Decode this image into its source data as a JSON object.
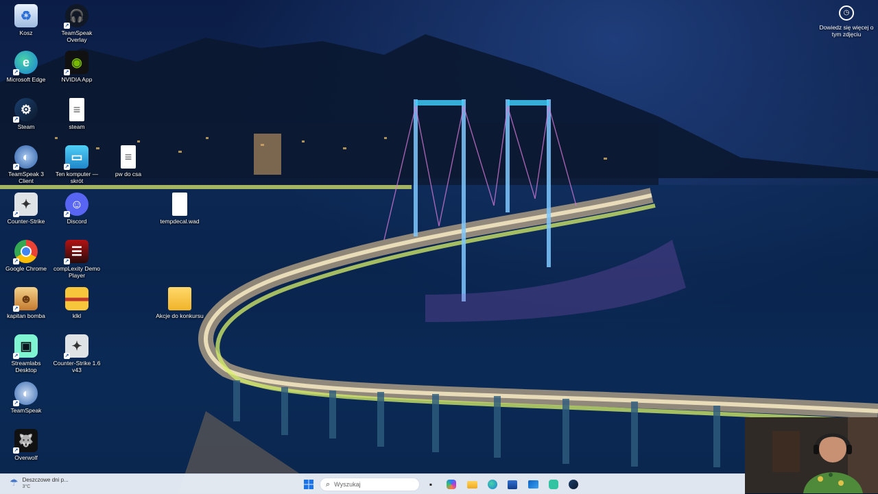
{
  "desktop": {
    "icons": [
      {
        "label": "Kosz",
        "icon": "recycle-bin-icon"
      },
      {
        "label": "TeamSpeak Overlay",
        "icon": "teamspeak-overlay-icon"
      },
      {
        "label": "Microsoft Edge",
        "icon": "edge-icon"
      },
      {
        "label": "NVIDIA App",
        "icon": "nvidia-icon"
      },
      {
        "label": "Steam",
        "icon": "steam-icon"
      },
      {
        "label": "steam",
        "icon": "text-file-icon"
      },
      {
        "label": "TeamSpeak 3 Client",
        "icon": "teamspeak3-icon"
      },
      {
        "label": "Ten komputer — skrót",
        "icon": "computer-icon"
      },
      {
        "label": "pw do csa",
        "icon": "text-file-icon"
      },
      {
        "label": "Counter-Strike",
        "icon": "counter-strike-icon"
      },
      {
        "label": "Discord",
        "icon": "discord-icon"
      },
      {
        "label": "tempdecal.wad",
        "icon": "file-icon"
      },
      {
        "label": "Google Chrome",
        "icon": "chrome-icon"
      },
      {
        "label": "compLexity Demo Player",
        "icon": "demo-player-icon"
      },
      {
        "label": "kapitan bomba",
        "icon": "kapitan-bomba-icon"
      },
      {
        "label": "klkl",
        "icon": "folder-archive-icon"
      },
      {
        "label": "Akcje do konkursu",
        "icon": "folder-icon"
      },
      {
        "label": "Streamlabs Desktop",
        "icon": "streamlabs-icon"
      },
      {
        "label": "Counter-Strike 1.6 v43",
        "icon": "counter-strike-16-icon"
      },
      {
        "label": "TeamSpeak",
        "icon": "teamspeak-icon"
      },
      {
        "label": "Overwolf",
        "icon": "overwolf-icon"
      }
    ],
    "learn_more": "Dowiedz się więcej o tym zdjęciu"
  },
  "taskbar": {
    "weather_title": "Deszczowe dni p...",
    "weather_temp": "3°C",
    "search_placeholder": "Wyszukaj",
    "apps": [
      "start-icon",
      "task-view-icon",
      "copilot-icon",
      "file-explorer-icon",
      "edge-icon",
      "store-icon",
      "outlook-icon",
      "streamlabs-icon",
      "steam-icon"
    ]
  },
  "colors": {
    "taskbar_bg": "#e8eef6",
    "accent": "#0a5bd8"
  }
}
